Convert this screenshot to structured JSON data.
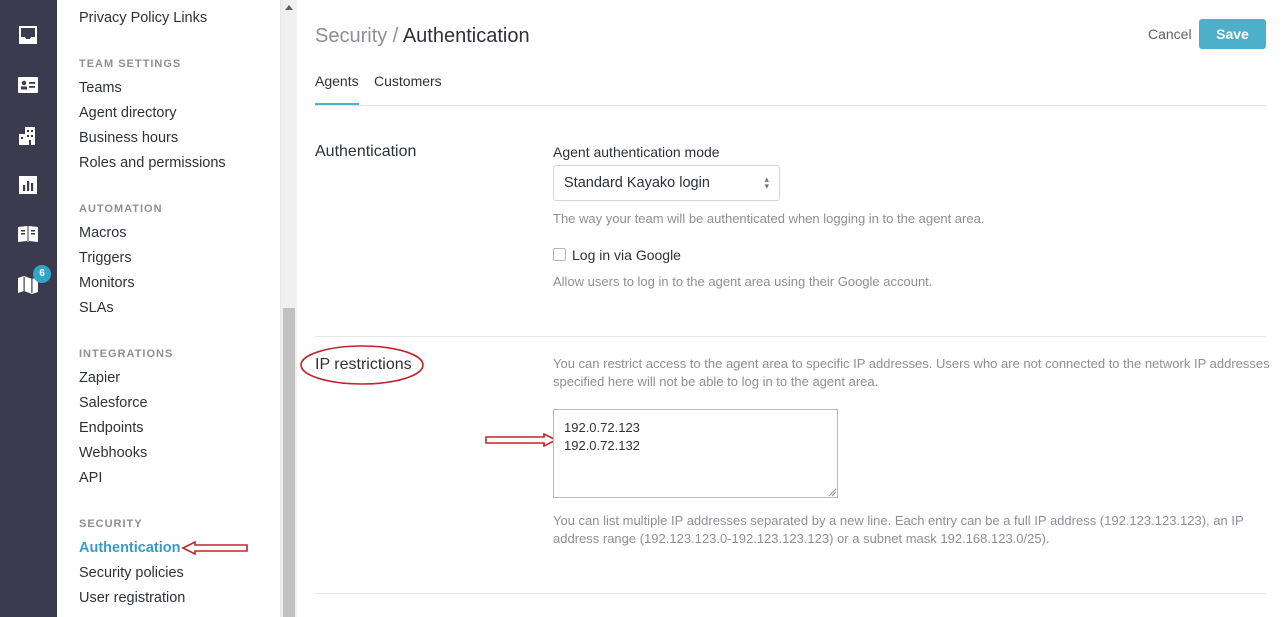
{
  "rail": {
    "icons": [
      "inbox-icon",
      "contact-card-icon",
      "organizations-icon",
      "insights-icon",
      "help-center-icon",
      "map-icon"
    ],
    "badge_count": "6",
    "bg_color": "#3b3a4f"
  },
  "nav": {
    "top_link": "Privacy Policy Links",
    "team_settings": {
      "heading": "TEAM SETTINGS",
      "items": [
        "Teams",
        "Agent directory",
        "Business hours",
        "Roles and permissions"
      ]
    },
    "automation": {
      "heading": "AUTOMATION",
      "items": [
        "Macros",
        "Triggers",
        "Monitors",
        "SLAs"
      ]
    },
    "integrations": {
      "heading": "INTEGRATIONS",
      "items": [
        "Zapier",
        "Salesforce",
        "Endpoints",
        "Webhooks",
        "API"
      ]
    },
    "security": {
      "heading": "SECURITY",
      "items": [
        "Authentication",
        "Security policies",
        "User registration"
      ],
      "active": "Authentication"
    }
  },
  "header": {
    "breadcrumb_parent": "Security / ",
    "breadcrumb_current": "Authentication",
    "cancel_label": "Cancel",
    "save_label": "Save"
  },
  "tabs": [
    {
      "label": "Agents",
      "active": true
    },
    {
      "label": "Customers",
      "active": false
    }
  ],
  "authentication": {
    "title": "Authentication",
    "mode_label": "Agent authentication mode",
    "mode_value": "Standard Kayako login",
    "mode_help": "The way your team will be authenticated when logging in to the agent area.",
    "google_label": "Log in via Google",
    "google_checked": false,
    "google_help": "Allow users to log in to the agent area using their Google account."
  },
  "ip_restrictions": {
    "title": "IP restrictions",
    "intro_line1": "You can restrict access to the agent area to specific IP addresses. Users who are not connected to the network IP addresses",
    "intro_line2": "specified here will not be able to log in to the agent area.",
    "value": "192.0.72.123\n192.0.72.132",
    "help_line1": "You can list multiple IP addresses separated by a new line. Each entry can be a full IP address (192.123.123.123), an IP",
    "help_line2": "address range (192.123.123.0-192.123.123.123) or a subnet mask 192.168.123.0/25)."
  },
  "colors": {
    "accent": "#4eafcb",
    "active_link": "#3b9bc6",
    "annotation": "#c0252b"
  }
}
